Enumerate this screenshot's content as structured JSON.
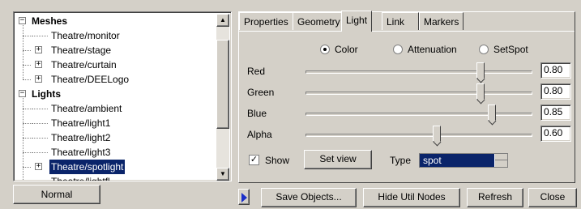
{
  "tree": {
    "groups": [
      {
        "label": "Meshes",
        "items": [
          {
            "label": "Theatre/monitor",
            "expandable": false
          },
          {
            "label": "Theatre/stage",
            "expandable": true
          },
          {
            "label": "Theatre/curtain",
            "expandable": true
          },
          {
            "label": "Theatre/DEELogo",
            "expandable": true
          }
        ]
      },
      {
        "label": "Lights",
        "items": [
          {
            "label": "Theatre/ambient",
            "expandable": false
          },
          {
            "label": "Theatre/light1",
            "expandable": false
          },
          {
            "label": "Theatre/light2",
            "expandable": false
          },
          {
            "label": "Theatre/light3",
            "expandable": false
          },
          {
            "label": "Theatre/spotlight",
            "expandable": true,
            "selected": true
          },
          {
            "label": "Theatre/lightfl",
            "expandable": false
          }
        ]
      }
    ],
    "expander_collapsed": "+",
    "expander_expanded": "−",
    "scroll_up_icon": "▲",
    "scroll_down_icon": "▼"
  },
  "bottom_left_tab": "Normal",
  "tabs": [
    "Properties",
    "Geometry",
    "Light",
    "Link",
    "Markers"
  ],
  "active_tab": "Light",
  "light_mode": {
    "options": [
      "Color",
      "Attenuation",
      "SetSpot"
    ],
    "selected": "Color"
  },
  "sliders": [
    {
      "label": "Red",
      "value": "0.80",
      "fraction": 0.8
    },
    {
      "label": "Green",
      "value": "0.80",
      "fraction": 0.8
    },
    {
      "label": "Blue",
      "value": "0.85",
      "fraction": 0.85
    },
    {
      "label": "Alpha",
      "value": "0.60",
      "fraction": 0.6
    }
  ],
  "show": {
    "label": "Show",
    "checked": true,
    "check_glyph": "✓"
  },
  "set_view_label": "Set view",
  "type": {
    "label": "Type",
    "value": "spot"
  },
  "toolbar": {
    "save_objects": "Save Objects...",
    "hide_util_nodes": "Hide Util Nodes",
    "refresh": "Refresh",
    "close": "Close"
  },
  "colors": {
    "selection": "#0a246a",
    "face": "#d4d0c8",
    "play_arrow": "#1a2ec8"
  }
}
